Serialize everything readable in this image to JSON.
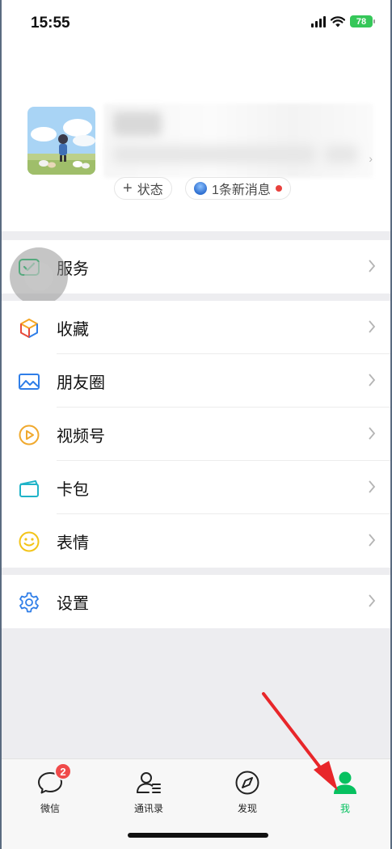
{
  "status_bar": {
    "time": "15:55",
    "battery": "78"
  },
  "profile": {
    "status_label": "状态",
    "news_label": "1条新消息"
  },
  "menu_groups": [
    {
      "items": [
        {
          "label": "服务",
          "icon": "wechat-pay-icon"
        }
      ]
    },
    {
      "items": [
        {
          "label": "收藏",
          "icon": "favorites-cube-icon"
        },
        {
          "label": "朋友圈",
          "icon": "moments-image-icon"
        },
        {
          "label": "视频号",
          "icon": "channels-play-icon"
        },
        {
          "label": "卡包",
          "icon": "card-wallet-icon"
        },
        {
          "label": "表情",
          "icon": "sticker-smile-icon"
        }
      ]
    },
    {
      "items": [
        {
          "label": "设置",
          "icon": "settings-gear-icon"
        }
      ]
    }
  ],
  "tabbar": {
    "tabs": [
      {
        "label": "微信",
        "icon": "chat-bubble-icon",
        "badge": "2",
        "active": false
      },
      {
        "label": "通讯录",
        "icon": "contacts-icon",
        "active": false
      },
      {
        "label": "发现",
        "icon": "discover-compass-icon",
        "active": false
      },
      {
        "label": "我",
        "icon": "me-person-icon",
        "active": true
      }
    ]
  },
  "colors": {
    "accent": "#07c160",
    "badge": "#f04a4a",
    "annotation_arrow": "#e8262a"
  }
}
